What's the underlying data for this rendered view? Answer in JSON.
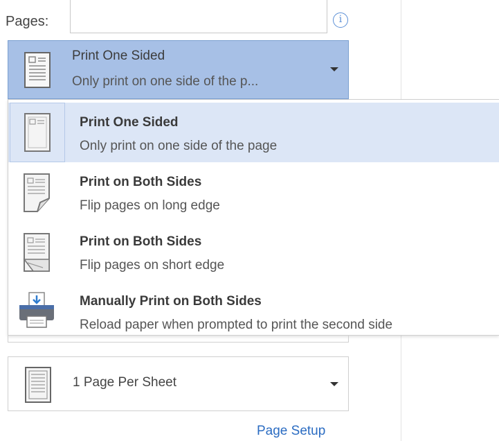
{
  "pages": {
    "label": "Pages:",
    "value": "",
    "info_icon": "info-icon"
  },
  "sides_selector": {
    "title": "Print One Sided",
    "subtitle": "Only print on one side of the p...",
    "icon": "one-sided-page-icon"
  },
  "sides_options": [
    {
      "title": "Print One Sided",
      "subtitle": "Only print on one side of the page",
      "icon": "one-sided-page-icon",
      "selected": true
    },
    {
      "title": "Print on Both Sides",
      "subtitle": "Flip pages on long edge",
      "icon": "flip-long-edge-icon",
      "selected": false
    },
    {
      "title": "Print on Both Sides",
      "subtitle": "Flip pages on short edge",
      "icon": "flip-short-edge-icon",
      "selected": false
    },
    {
      "title": "Manually Print on Both Sides",
      "subtitle": "Reload paper when prompted to print the second side",
      "icon": "printer-icon",
      "selected": false
    }
  ],
  "pages_per_sheet": {
    "label": "1 Page Per Sheet",
    "icon": "page-per-sheet-icon"
  },
  "page_setup_link": "Page Setup",
  "colors": {
    "selector_bg": "#a7c0e6",
    "highlight": "#dce6f6",
    "link": "#2b6cc2"
  }
}
